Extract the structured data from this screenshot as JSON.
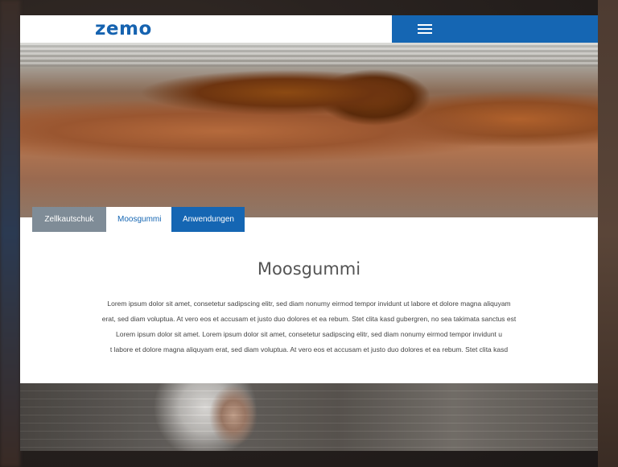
{
  "header": {
    "logo_text": "zemo",
    "menu_icon": "hamburger-icon",
    "brand_color": "#1566b3"
  },
  "tabs": [
    {
      "label": "Zellkautschuk",
      "color": "#7f8c97"
    },
    {
      "label": "Moosgummi",
      "color": "#ffffff",
      "active": true
    },
    {
      "label": "Anwendungen",
      "color": "#1566b3"
    }
  ],
  "content": {
    "title": "Moosgummi",
    "lines": [
      "Lorem ipsum dolor sit amet, consetetur sadipscing elitr, sed diam nonumy eirmod tempor invidunt ut labore et dolore magna aliquyam",
      "erat, sed diam voluptua. At vero eos et accusam et justo duo dolores et ea rebum. Stet clita kasd gubergren, no sea takimata sanctus est",
      "Lorem ipsum dolor sit amet. Lorem ipsum dolor sit amet, consetetur sadipscing elitr, sed diam nonumy eirmod tempor invidunt u",
      "t labore et dolore magna aliquyam erat, sed diam voluptua. At vero eos et accusam et justo duo dolores et ea rebum. Stet clita kasd"
    ]
  }
}
